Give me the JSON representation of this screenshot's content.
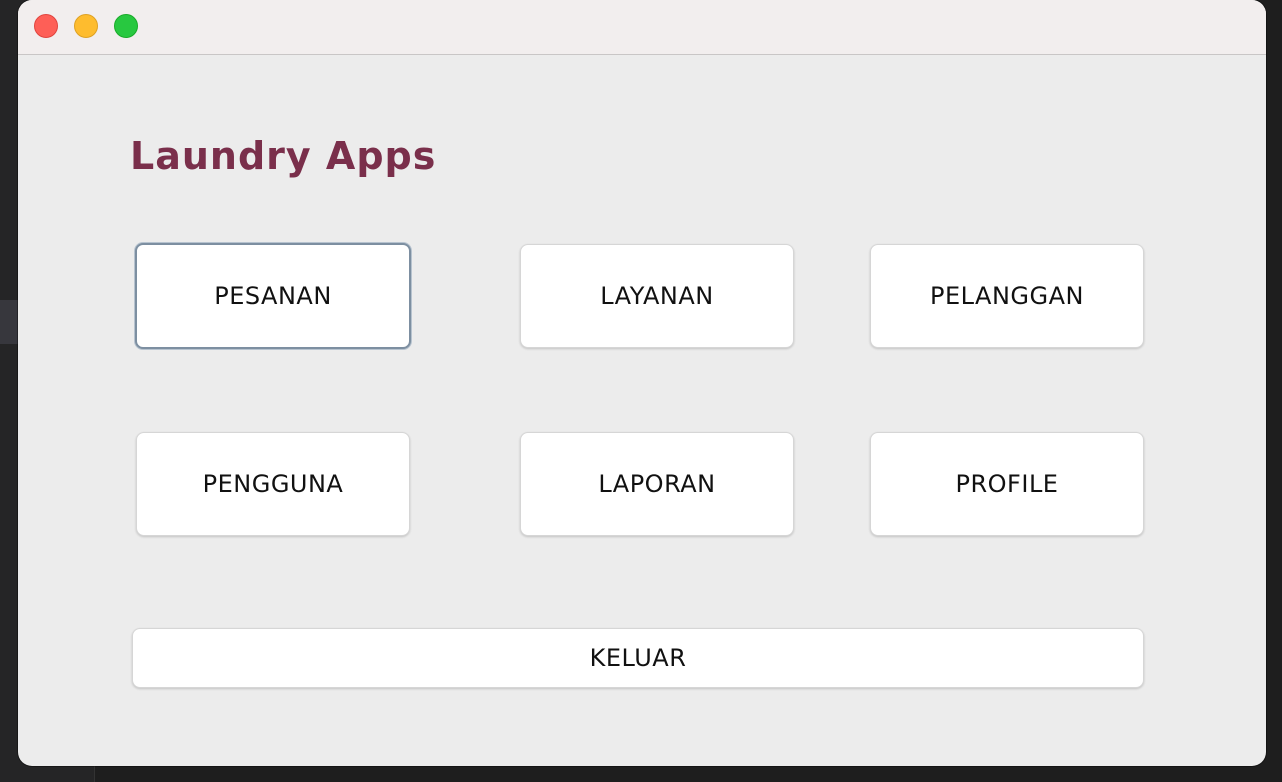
{
  "window": {
    "title": ""
  },
  "app": {
    "title": "Laundry Apps"
  },
  "buttons": {
    "pesanan": "PESANAN",
    "layanan": "LAYANAN",
    "pelanggan": "PELANGGAN",
    "pengguna": "PENGGUNA",
    "laporan": "LAPORAN",
    "profile": "PROFILE",
    "keluar": "KELUAR"
  },
  "colors": {
    "title": "#7a2f4b",
    "window_bg": "#ececec",
    "titlebar_bg": "#f2eeee",
    "button_bg": "#ffffff",
    "focus_ring": "#7d8fa1"
  }
}
